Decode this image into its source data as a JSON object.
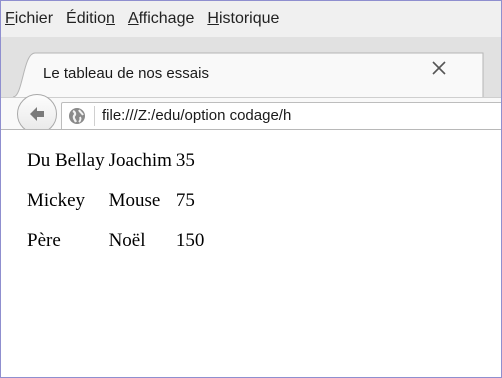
{
  "menubar": {
    "items": [
      {
        "label_pre": "",
        "label_acc": "F",
        "label_post": "ichier"
      },
      {
        "label_pre": "Éditio",
        "label_acc": "n",
        "label_post": ""
      },
      {
        "label_pre": "",
        "label_acc": "A",
        "label_post": "ffichage"
      },
      {
        "label_pre": "",
        "label_acc": "H",
        "label_post": "istorique"
      }
    ]
  },
  "tab": {
    "title": "Le tableau de nos essais",
    "close_icon": "close-icon"
  },
  "navbar": {
    "back_icon": "back-arrow-icon",
    "site_icon": "globe-icon",
    "url": "file:///Z:/edu/option codage/h"
  },
  "page": {
    "rows": [
      [
        "Du Bellay",
        "Joachim",
        "35"
      ],
      [
        "Mickey",
        "Mouse",
        "75"
      ],
      [
        "Père",
        "Noël",
        "150"
      ]
    ]
  },
  "colors": {
    "frame_border": "#8f8fcf",
    "menubar_bg": "#f0f0f0",
    "tabstrip_bg": "#e1e1e1",
    "navbar_bg": "#f9f9f9"
  }
}
